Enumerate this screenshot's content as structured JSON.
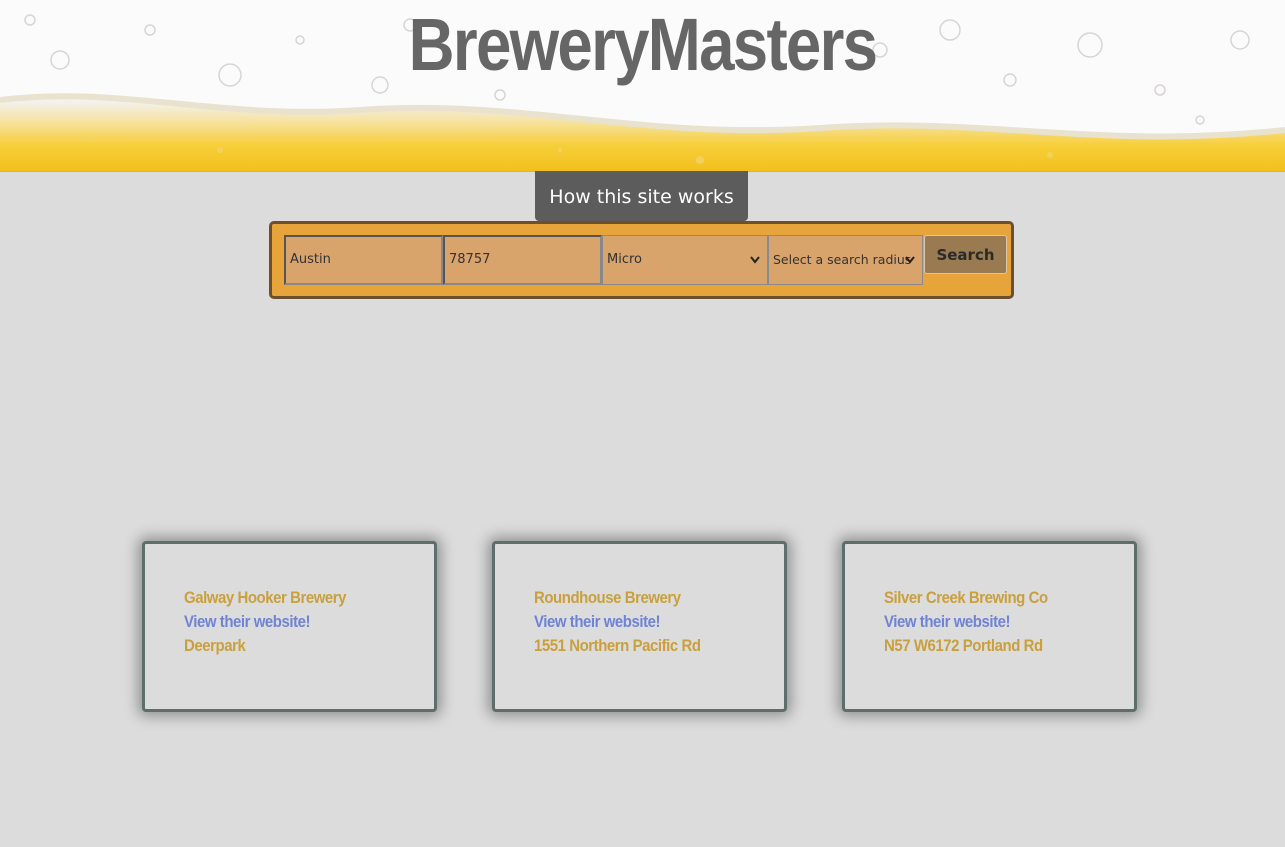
{
  "header": {
    "title": "BreweryMasters"
  },
  "how_button": {
    "label": "How this site works"
  },
  "search": {
    "city_value": "Austin",
    "zip_value": "78757",
    "type_selected": "Micro",
    "radius_selected": "Select a search radius",
    "button_label": "Search"
  },
  "results": [
    {
      "name": "Galway Hooker Brewery",
      "link_label": "View their website!",
      "address": "Deerpark"
    },
    {
      "name": "Roundhouse Brewery",
      "link_label": "View their website!",
      "address": "1551 Northern Pacific Rd"
    },
    {
      "name": "Silver Creek Brewing Co",
      "link_label": "View their website!",
      "address": "N57 W6172 Portland Rd"
    }
  ],
  "colors": {
    "page_background": "#dcdcdc",
    "search_bar": "#e7a43a",
    "brewery_name": "#c9a03e",
    "link": "#6f83d6"
  }
}
